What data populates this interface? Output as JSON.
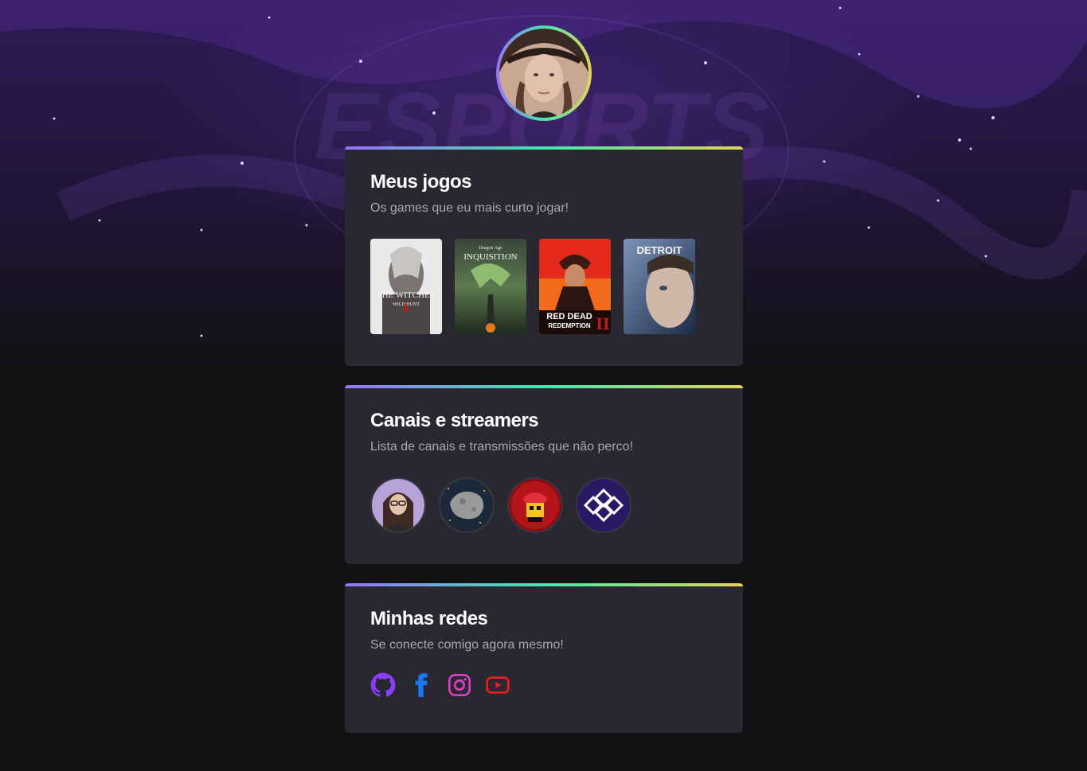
{
  "colors": {
    "gradient_start": "#9572fc",
    "gradient_mid": "#43e7ad",
    "gradient_end": "#e2d45c",
    "card_bg": "#29272f",
    "page_bg": "#121214",
    "github": "#8b3dff",
    "facebook": "#1877f2",
    "instagram": "#e1306c",
    "youtube": "#ff0000"
  },
  "background": {
    "watermark_text": "ESPORTS"
  },
  "profile": {
    "avatar_icon": "user-photo"
  },
  "games_section": {
    "title": "Meus jogos",
    "subtitle": "Os games que eu mais curto jogar!",
    "games": [
      {
        "cover_text": "THE WITCHER",
        "cover_subtext": "WILD HUNT"
      },
      {
        "cover_text": "INQUISITION",
        "cover_subtext": "Dragon Age"
      },
      {
        "cover_text": "RED DEAD",
        "cover_subtext": "REDEMPTION"
      },
      {
        "cover_text": "DETROIT",
        "cover_subtext": ""
      }
    ]
  },
  "channels_section": {
    "title": "Canais e streamers",
    "subtitle": "Lista de canais e transmissões que não perco!",
    "channels": [
      {
        "icon": "streamer-girl-avatar"
      },
      {
        "icon": "asteroid-avatar"
      },
      {
        "icon": "red-character-avatar"
      },
      {
        "icon": "purple-logo-avatar"
      }
    ]
  },
  "socials_section": {
    "title": "Minhas redes",
    "subtitle": "Se conecte comigo agora mesmo!",
    "links": [
      {
        "icon": "github-icon"
      },
      {
        "icon": "facebook-icon"
      },
      {
        "icon": "instagram-icon"
      },
      {
        "icon": "youtube-icon"
      }
    ]
  }
}
